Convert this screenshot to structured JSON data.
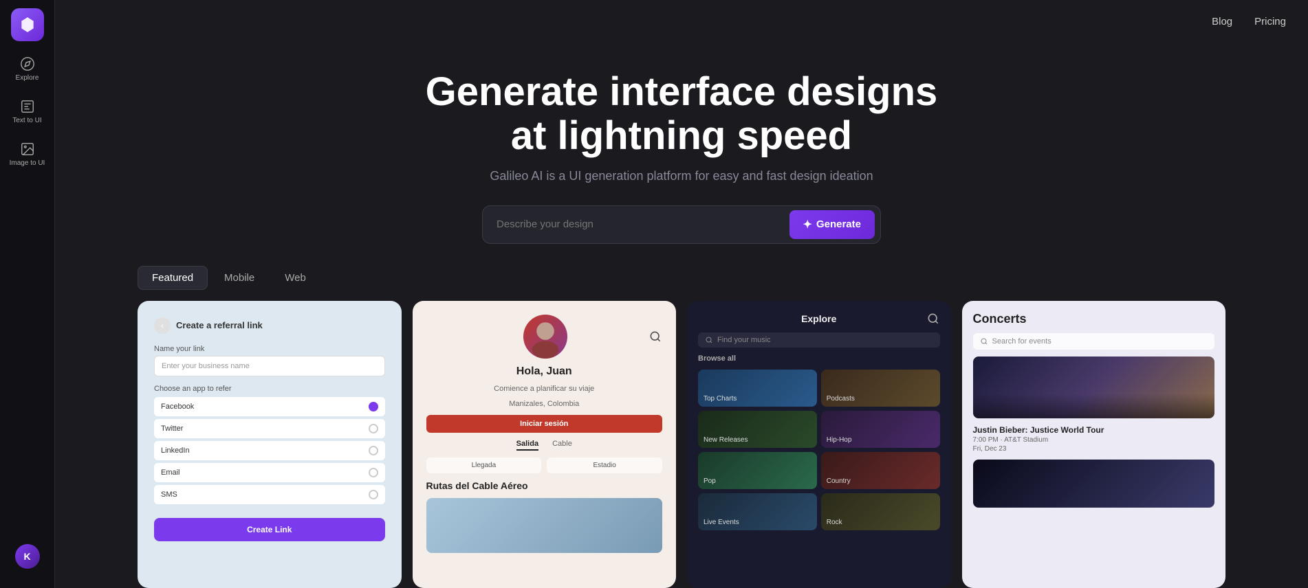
{
  "sidebar": {
    "logo_label": "Galileo",
    "items": [
      {
        "id": "explore",
        "label": "Explore",
        "icon": "explore"
      },
      {
        "id": "text-to-ui",
        "label": "Text to UI",
        "icon": "text"
      },
      {
        "id": "image-to-ui",
        "label": "Image to UI",
        "icon": "image"
      }
    ],
    "avatar_initials": "K"
  },
  "topnav": {
    "blog_label": "Blog",
    "pricing_label": "Pricing"
  },
  "hero": {
    "title": "Generate interface designs at lightning speed",
    "subtitle": "Galileo AI is a UI generation platform for easy and fast design ideation",
    "search_placeholder": "Describe your design",
    "generate_label": "Generate"
  },
  "tabs": [
    {
      "id": "featured",
      "label": "Featured",
      "active": true
    },
    {
      "id": "mobile",
      "label": "Mobile",
      "active": false
    },
    {
      "id": "web",
      "label": "Web",
      "active": false
    }
  ],
  "cards": [
    {
      "id": "card-referral",
      "title": "Create a referral link",
      "field_label": "Name your link",
      "field_placeholder": "Enter your business name",
      "section_label": "Choose an app to refer",
      "apps": [
        {
          "name": "Facebook",
          "selected": true
        },
        {
          "name": "Twitter",
          "selected": false
        },
        {
          "name": "LinkedIn",
          "selected": false
        },
        {
          "name": "Email",
          "selected": false
        },
        {
          "name": "SMS",
          "selected": false
        }
      ],
      "cta": "Create Link"
    },
    {
      "id": "card-travel",
      "user_name": "Hola, Juan",
      "user_sub": "Comience a planificar su viaje",
      "user_location": "Manizales, Colombia",
      "cta": "Iniciar sesión",
      "tabs": [
        "Salida",
        "Cable"
      ],
      "labels": [
        "Llegada",
        "Estadio"
      ],
      "route_title": "Rutas del Cable Aéreo"
    },
    {
      "id": "card-music",
      "title": "Explore",
      "search_placeholder": "Find your music",
      "section_label": "Browse all",
      "tiles": [
        "Top Charts",
        "Podcasts",
        "New Releases",
        "Hip-Hop",
        "Pop",
        "Country",
        "Live Events",
        "Rock"
      ]
    },
    {
      "id": "card-concerts",
      "title": "Concerts",
      "search_placeholder": "Search for events",
      "event_title": "Justin Bieber: Justice World Tour",
      "event_time": "7:00 PM · AT&T Stadium",
      "event_date": "Fri, Dec 23"
    }
  ]
}
